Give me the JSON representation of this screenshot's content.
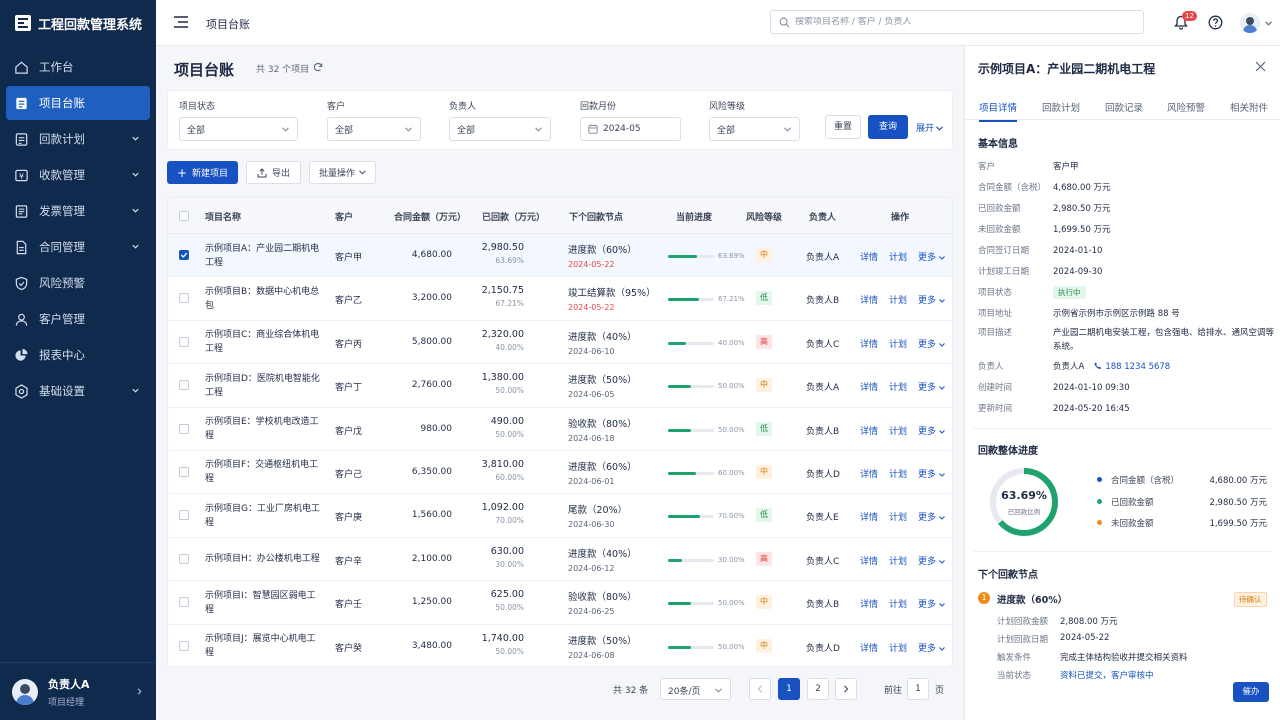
{
  "app": {
    "title": "工程回款管理系统"
  },
  "sidebar": {
    "items": [
      {
        "label": "工作台"
      },
      {
        "label": "项目台账"
      },
      {
        "label": "回款计划"
      },
      {
        "label": "收款管理"
      },
      {
        "label": "发票管理"
      },
      {
        "label": "合同管理"
      },
      {
        "label": "风险预警"
      },
      {
        "label": "客户管理"
      },
      {
        "label": "报表中心"
      },
      {
        "label": "基础设置"
      }
    ],
    "user": {
      "name": "负责人A",
      "role": "项目经理"
    }
  },
  "topbar": {
    "breadcrumb": "项目台账",
    "search_placeholder": "搜索项目名称 / 客户 / 负责人",
    "notification_count": "12"
  },
  "page": {
    "title": "项目台账",
    "count": "共 32 个项目"
  },
  "filters": {
    "status": {
      "label": "项目状态",
      "value": "全部"
    },
    "customer": {
      "label": "客户",
      "value": "全部"
    },
    "owner": {
      "label": "负责人",
      "value": "全部"
    },
    "month": {
      "label": "回款月份",
      "value": "2024-05"
    },
    "risk": {
      "label": "风险等级",
      "value": "全部"
    },
    "reset": "重置",
    "query": "查询",
    "expand": "展开"
  },
  "actions": {
    "new": "新建项目",
    "export": "导出",
    "batch": "批量操作"
  },
  "table": {
    "headers": [
      "项目名称",
      "客户",
      "合同金额（万元）",
      "已回款（万元）",
      "下个回款节点",
      "当前进度",
      "风险等级",
      "负责人",
      "操作"
    ],
    "ops": {
      "detail": "详情",
      "plan": "计划",
      "more": "更多"
    },
    "rows": [
      {
        "name": "示例项目A：产业园二期机电工程",
        "customer": "客户甲",
        "contract": "4,680.00",
        "received": "2,980.50",
        "received_pct": "63.69%",
        "node": "进度款（60%）",
        "node_date": "2024-05-22",
        "node_date_red": true,
        "progress": 63.69,
        "progress_text": "63.69%",
        "risk": "中",
        "risk_level": "mid",
        "owner": "负责人A",
        "selected": true
      },
      {
        "name": "示例项目B：数据中心机电总包",
        "customer": "客户乙",
        "contract": "3,200.00",
        "received": "2,150.75",
        "received_pct": "67.21%",
        "node": "竣工结算款（95%）",
        "node_date": "2024-05-22",
        "node_date_red": true,
        "progress": 67.21,
        "progress_text": "67.21%",
        "risk": "低",
        "risk_level": "low",
        "owner": "负责人B",
        "selected": false
      },
      {
        "name": "示例项目C：商业综合体机电工程",
        "customer": "客户丙",
        "contract": "5,800.00",
        "received": "2,320.00",
        "received_pct": "40.00%",
        "node": "进度款（40%）",
        "node_date": "2024-06-10",
        "node_date_red": false,
        "progress": 40,
        "progress_text": "40.00%",
        "risk": "高",
        "risk_level": "high",
        "owner": "负责人C",
        "selected": false
      },
      {
        "name": "示例项目D：医院机电智能化工程",
        "customer": "客户丁",
        "contract": "2,760.00",
        "received": "1,380.00",
        "received_pct": "50.00%",
        "node": "进度款（50%）",
        "node_date": "2024-06-05",
        "node_date_red": false,
        "progress": 50,
        "progress_text": "50.00%",
        "risk": "中",
        "risk_level": "mid",
        "owner": "负责人A",
        "selected": false
      },
      {
        "name": "示例项目E：学校机电改造工程",
        "customer": "客户戊",
        "contract": "980.00",
        "received": "490.00",
        "received_pct": "50.00%",
        "node": "验收款（80%）",
        "node_date": "2024-06-18",
        "node_date_red": false,
        "progress": 50,
        "progress_text": "50.00%",
        "risk": "低",
        "risk_level": "low",
        "owner": "负责人B",
        "selected": false
      },
      {
        "name": "示例项目F：交通枢纽机电工程",
        "customer": "客户己",
        "contract": "6,350.00",
        "received": "3,810.00",
        "received_pct": "60.00%",
        "node": "进度款（60%）",
        "node_date": "2024-06-01",
        "node_date_red": false,
        "progress": 60,
        "progress_text": "60.00%",
        "risk": "中",
        "risk_level": "mid",
        "owner": "负责人D",
        "selected": false
      },
      {
        "name": "示例项目G：工业厂房机电工程",
        "customer": "客户庚",
        "contract": "1,560.00",
        "received": "1,092.00",
        "received_pct": "70.00%",
        "node": "尾款（20%）",
        "node_date": "2024-06-30",
        "node_date_red": false,
        "progress": 70,
        "progress_text": "70.00%",
        "risk": "低",
        "risk_level": "low",
        "owner": "负责人E",
        "selected": false
      },
      {
        "name": "示例项目H：办公楼机电工程",
        "customer": "客户辛",
        "contract": "2,100.00",
        "received": "630.00",
        "received_pct": "30.00%",
        "node": "进度款（40%）",
        "node_date": "2024-06-12",
        "node_date_red": false,
        "progress": 30,
        "progress_text": "30.00%",
        "risk": "高",
        "risk_level": "high",
        "owner": "负责人C",
        "selected": false
      },
      {
        "name": "示例项目I：智慧园区弱电工程",
        "customer": "客户壬",
        "contract": "1,250.00",
        "received": "625.00",
        "received_pct": "50.00%",
        "node": "验收款（80%）",
        "node_date": "2024-06-25",
        "node_date_red": false,
        "progress": 50,
        "progress_text": "50.00%",
        "risk": "中",
        "risk_level": "mid",
        "owner": "负责人B",
        "selected": false
      },
      {
        "name": "示例项目J：展览中心机电工程",
        "customer": "客户癸",
        "contract": "3,480.00",
        "received": "1,740.00",
        "received_pct": "50.00%",
        "node": "进度款（50%）",
        "node_date": "2024-06-08",
        "node_date_red": false,
        "progress": 50,
        "progress_text": "50.00%",
        "risk": "中",
        "risk_level": "mid",
        "owner": "负责人D",
        "selected": false
      }
    ]
  },
  "pagination": {
    "total": "共 32 条",
    "page_size": "20条/页",
    "pages": [
      "1",
      "2"
    ],
    "goto": "前往",
    "goto_value": "1",
    "goto_suffix": "页"
  },
  "panel": {
    "title": "示例项目A：产业园二期机电工程",
    "tabs": [
      "项目详情",
      "回款计划",
      "回款记录",
      "风险预警",
      "相关附件"
    ],
    "basic_title": "基本信息",
    "basic": {
      "customer_k": "客户",
      "customer_v": "客户甲",
      "contract_k": "合同金额（含税）",
      "contract_v": "4,680.00 万元",
      "received_k": "已回款金额",
      "received_v": "2,980.50 万元",
      "unreceived_k": "未回款金额",
      "unreceived_v": "1,699.50 万元",
      "sign_k": "合同签订日期",
      "sign_v": "2024-01-10",
      "finish_k": "计划竣工日期",
      "finish_v": "2024-09-30",
      "status_k": "项目状态",
      "status_v": "执行中",
      "addr_k": "项目地址",
      "addr_v": "示例省示例市示例区示例路 88 号",
      "desc_k": "项目描述",
      "desc_v": "产业园二期机电安装工程，包含强电、给排水、通风空调等系统。",
      "owner_k": "负责人",
      "owner_v": "负责人A",
      "phone": "188 1234 5678",
      "created_k": "创建时间",
      "created_v": "2024-01-10 09:30",
      "updated_k": "更新时间",
      "updated_v": "2024-05-20 16:45"
    },
    "overall": {
      "title": "回款整体进度",
      "percent_text": "63.69%",
      "percent": 63.69,
      "center_label": "已回款比例",
      "legend": [
        {
          "name": "合同金额（含税）",
          "value": "4,680.00 万元",
          "color": "#1852c2"
        },
        {
          "name": "已回款金额",
          "value": "2,980.50 万元",
          "color": "#1fa36e"
        },
        {
          "name": "未回款金额",
          "value": "1,699.50 万元",
          "color": "#f08a18"
        }
      ]
    },
    "next_node": {
      "title": "下个回款节点",
      "index": "1",
      "name": "进度款（60%）",
      "tag": "待确认",
      "amount_k": "计划回款金额",
      "amount_v": "2,808.00 万元",
      "date_k": "计划回款日期",
      "date_v": "2024-05-22",
      "trigger_k": "触发条件",
      "trigger_v": "完成主体结构验收并提交相关资料",
      "state_k": "当前状态",
      "state_v": "资料已提交，客户审核中",
      "urge": "催办"
    }
  }
}
